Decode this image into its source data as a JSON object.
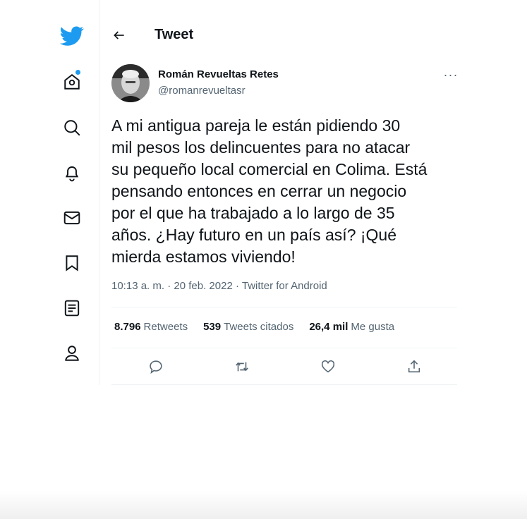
{
  "colors": {
    "brand": "#1d9bf0",
    "text": "#0f1419",
    "secondary": "#536471"
  },
  "nav": {
    "icons": [
      "twitter-logo-icon",
      "home-icon",
      "search-icon",
      "bell-icon",
      "mail-icon",
      "bookmark-icon",
      "list-icon",
      "profile-icon"
    ],
    "home_has_notification_dot": true
  },
  "header": {
    "title": "Tweet"
  },
  "tweet": {
    "author_name": "Román Revueltas Retes",
    "author_handle": "@romanrevueltasr",
    "text": "A mi antigua pareja le están pidiendo 30\nmil pesos los delincuentes para no atacar\nsu pequeño local comercial en Colima. Está\npensando entonces en cerrar un negocio\npor el que ha trabajado a lo largo de 35\naños. ¿Hay futuro en un país así? ¡Qué\nmierda estamos viviendo!",
    "time": "10:13 a. m.",
    "sep": "·",
    "date": "20 feb. 2022",
    "source": "Twitter for Android",
    "retweets_count": "8.796",
    "retweets_label": "Retweets",
    "quotes_count": "539",
    "quotes_label": "Tweets citados",
    "likes_count": "26,4 mil",
    "likes_label": "Me gusta",
    "more_label": "···"
  }
}
